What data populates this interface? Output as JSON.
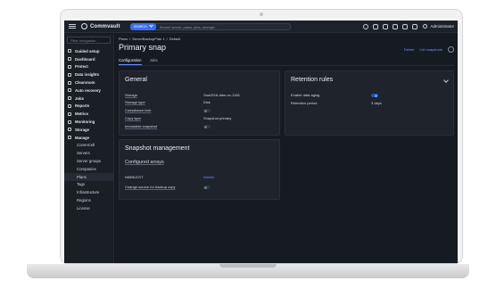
{
  "topbar": {
    "logo_text": "Commvault",
    "search_scope": "SEARCH",
    "search_placeholder": "Search server, plans, jobs, storage...",
    "user_name": "Administrator"
  },
  "sidebar": {
    "filter_placeholder": "Filter navigation...",
    "items": [
      {
        "label": "Guided setup"
      },
      {
        "label": "Dashboard"
      },
      {
        "label": "Protect"
      },
      {
        "label": "Data insights"
      },
      {
        "label": "Cleanroom"
      },
      {
        "label": "Auto recovery"
      },
      {
        "label": "Jobs"
      },
      {
        "label": "Reports"
      },
      {
        "label": "Metrics"
      },
      {
        "label": "Monitoring"
      },
      {
        "label": "Storage"
      },
      {
        "label": "Manage"
      }
    ],
    "sub_items": [
      {
        "label": "CommCell"
      },
      {
        "label": "Servers"
      },
      {
        "label": "Server groups"
      },
      {
        "label": "Companies"
      },
      {
        "label": "Plans"
      },
      {
        "label": "Tags"
      },
      {
        "label": "Infrastructure"
      },
      {
        "label": "Regions"
      },
      {
        "label": "License"
      }
    ]
  },
  "main": {
    "breadcrumb": [
      "Plans",
      "/",
      "ServerBackupPlan 1",
      "/",
      "Default"
    ],
    "title": "Primary snap",
    "actions": {
      "delete": "Delete",
      "list_snapshots": "List snapshots"
    },
    "tabs": [
      "Configuration",
      "Jobs"
    ],
    "general": {
      "title": "General",
      "rows": [
        {
          "label": "Storage",
          "value": "Gsa2016-ddm-cv-1106"
        },
        {
          "label": "Storage type",
          "value": "Disk"
        },
        {
          "label": "Compliance lock",
          "toggle": "off"
        },
        {
          "label": "Copy type",
          "value": "Snapshot primary"
        },
        {
          "label": "Immutable snapshot",
          "toggle": "off"
        }
      ]
    },
    "retention": {
      "title": "Retention rules",
      "rows": [
        {
          "label": "Enable data aging",
          "toggle": "on"
        },
        {
          "label": "Retention period",
          "value": "3 days"
        }
      ]
    },
    "snapshot": {
      "title": "Snapshot management",
      "subtitle": "Configured arrays",
      "rows": [
        {
          "label": "NIMBLEGT",
          "value": "Nimble"
        },
        {
          "label": "Change source for backup copy",
          "toggle": "off"
        }
      ]
    }
  },
  "colors": {
    "accent": "#3d6ef0",
    "link": "#6a95ff",
    "background": "#15181e"
  }
}
